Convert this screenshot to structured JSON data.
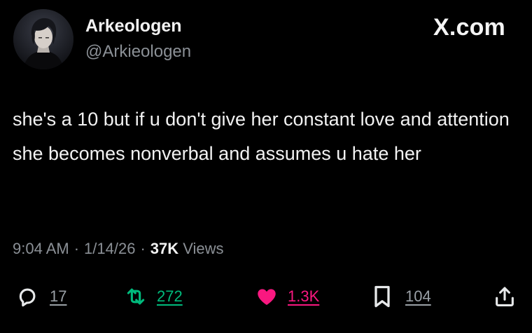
{
  "author": {
    "display_name": "Arkeologen",
    "handle": "@Arkieologen",
    "avatar_icon": "profile-avatar"
  },
  "site_label": "X.com",
  "post": {
    "text": "she's a 10 but if u don't give her constant love and attention she becomes nonverbal and assumes u hate her"
  },
  "meta": {
    "time": "9:04 AM",
    "separator": "·",
    "date": "1/14/26",
    "views_count": "37K",
    "views_label": "Views"
  },
  "actions": {
    "replies": "17",
    "reposts": "272",
    "likes": "1.3K",
    "bookmarks": "104"
  },
  "colors": {
    "background": "#000000",
    "text": "#f2f2f2",
    "muted": "#8b9096",
    "repost": "#00ba7c",
    "like": "#f91880"
  },
  "icons": {
    "reply": "reply-icon",
    "repost": "repost-icon",
    "like": "heart-icon",
    "bookmark": "bookmark-icon",
    "share": "share-icon"
  }
}
